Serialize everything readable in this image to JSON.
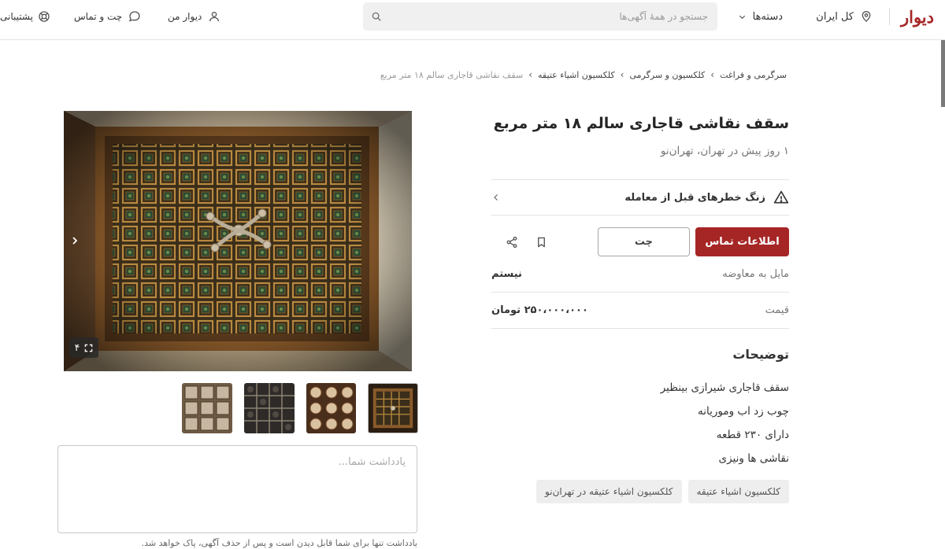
{
  "header": {
    "logo": "دیوار",
    "location": "کل ایران",
    "categories": "دسته‌ها",
    "search_placeholder": "جستجو در همهٔ آگهی‌ها",
    "my_divar": "دیوار من",
    "chat": "چت و تماس",
    "support": "پشتیبانی"
  },
  "breadcrumb": [
    "سرگرمی و فراغت",
    "کلکسیون و سرگرمی",
    "کلکسیون اشیاء عتیقه",
    "سقف نقاشی قاجاری سالم ۱۸ متر مربع"
  ],
  "ad": {
    "title": "سقف نقاشی قاجاری سالم ۱۸ متر مربع",
    "subtitle": "۱ روز پیش در تهران، تهران‌نو",
    "warning": "زنگ خطرهای قبل از معامله",
    "contact_button": "اطلاعات تماس",
    "chat_button": "چت",
    "fields": [
      {
        "label": "مایل به معاوضه",
        "value": "نیستم"
      },
      {
        "label": "قیمت",
        "value": "۲۵۰،۰۰۰،۰۰۰ تومان"
      }
    ],
    "description_title": "توضیحات",
    "description_lines": [
      "سقف قاجاری شیرازی بینظیر",
      "چوب زد اب وموریانه",
      "دارای ۲۳۰ قطعه",
      "نقاشی ها ونیزی"
    ],
    "tags": [
      "کلکسیون اشیاء عتیقه",
      "کلکسیون اشیاء عتیقه در تهران‌نو"
    ]
  },
  "gallery": {
    "image_count": "۴"
  },
  "note": {
    "placeholder": "یادداشت شما...",
    "hint": "یادداشت تنها برای شما قابل دیدن است و پس از حذف آگهی، پاک خواهد شد."
  },
  "colors": {
    "brand": "#a62626",
    "border": "#e2e2e2",
    "muted_text": "#777777"
  },
  "icons": [
    "location-icon",
    "chevron-down-icon",
    "search-icon",
    "user-icon",
    "chat-icon",
    "support-icon",
    "warning-icon",
    "chevron-left-icon",
    "bookmark-icon",
    "share-icon",
    "expand-icon"
  ]
}
